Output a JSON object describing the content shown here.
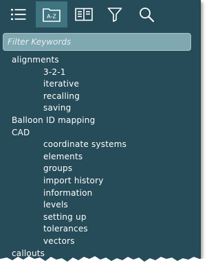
{
  "toolbar": {
    "buttons": [
      {
        "icon": "list-icon",
        "active": false
      },
      {
        "icon": "index-az-icon",
        "label": "A-Z",
        "active": true
      },
      {
        "icon": "book-icon",
        "active": false
      },
      {
        "icon": "filter-icon",
        "active": false
      },
      {
        "icon": "search-icon",
        "active": false
      }
    ]
  },
  "filter": {
    "placeholder": "Filter Keywords",
    "value": ""
  },
  "index": [
    {
      "label": "alignments"
    },
    {
      "label": "3-2-1"
    },
    {
      "label": "iterative"
    },
    {
      "label": "recalling"
    },
    {
      "label": "saving"
    },
    {
      "label": "Balloon ID mapping"
    },
    {
      "label": "CAD"
    },
    {
      "label": "coordinate systems"
    },
    {
      "label": "elements"
    },
    {
      "label": "groups"
    },
    {
      "label": "import history"
    },
    {
      "label": "information"
    },
    {
      "label": "levels"
    },
    {
      "label": "setting up"
    },
    {
      "label": "tolerances"
    },
    {
      "label": "vectors"
    },
    {
      "label": "callouts"
    }
  ],
  "colors": {
    "panel": "#264b59",
    "active_tab": "#3f7480",
    "filter_bg": "#7fa8b1",
    "text": "#ffffff"
  }
}
